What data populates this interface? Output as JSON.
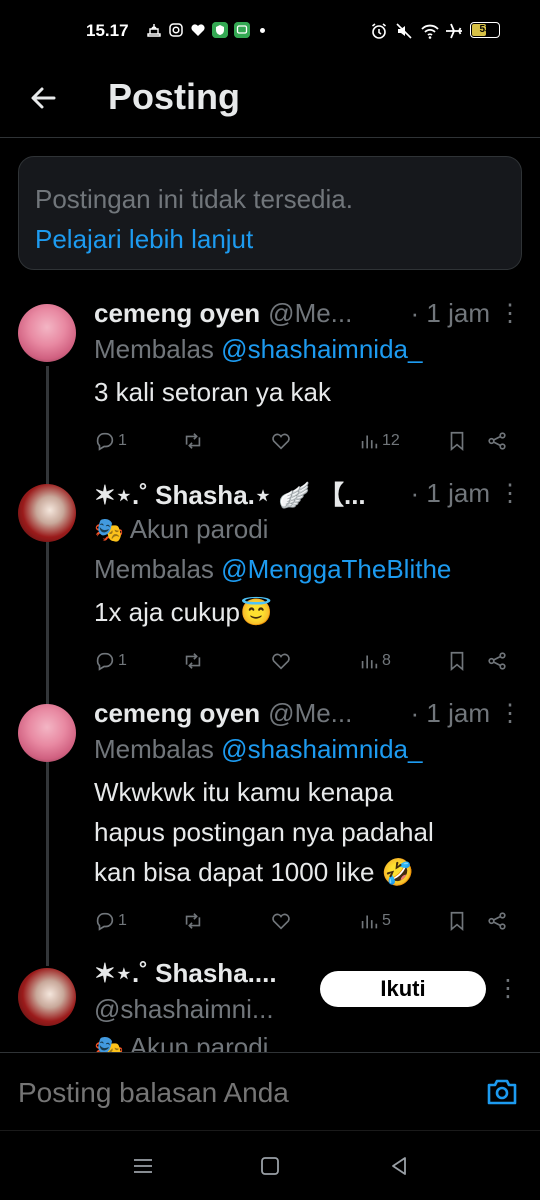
{
  "status_bar": {
    "time": "15.17",
    "battery": "53",
    "battery_level_percent": 53
  },
  "header": {
    "title": "Posting"
  },
  "notice": {
    "text": "Postingan ini tidak tersedia.",
    "link": "Pelajari lebih lanjut"
  },
  "tweets": [
    {
      "name": "cemeng oyen",
      "handle": "@Me...",
      "time": "· 1 jam",
      "reply_prefix": "Membalas",
      "reply_to": "@shashaimnida_",
      "text": "3 kali setoran ya kak",
      "replies": "1",
      "views": "12"
    },
    {
      "name": "✶⋆.˚ Shasha.⋆ 🪽 【...",
      "time": "· 1 jam",
      "badge": "Akun parodi",
      "reply_prefix": "Membalas",
      "reply_to": "@MenggaTheBlithe",
      "text": "1x aja cukup😇",
      "replies": "1",
      "views": "8"
    },
    {
      "name": "cemeng oyen",
      "handle": "@Me...",
      "time": "· 1 jam",
      "reply_prefix": "Membalas",
      "reply_to": "@shashaimnida_",
      "text_lines": [
        "Wkwkwk itu kamu kenapa",
        "hapus postingan nya padahal",
        "kan bisa dapat 1000 like 🤣"
      ],
      "replies": "1",
      "views": "5"
    },
    {
      "name": "✶⋆.˚ Shasha....",
      "handle": "@shashaimni...",
      "badge": "Akun parodi",
      "follow_label": "Ikuti"
    }
  ],
  "composer": {
    "placeholder": "Posting balasan Anda"
  },
  "colors": {
    "background": "#000000",
    "accent": "#1d9bf0",
    "muted": "#71767b",
    "text": "#e7e9ea"
  },
  "icons": [
    "back-arrow-icon",
    "reply-icon",
    "retweet-icon",
    "like-icon",
    "views-icon",
    "bookmark-icon",
    "share-icon",
    "more-icon",
    "camera-icon",
    "mask-icon"
  ]
}
